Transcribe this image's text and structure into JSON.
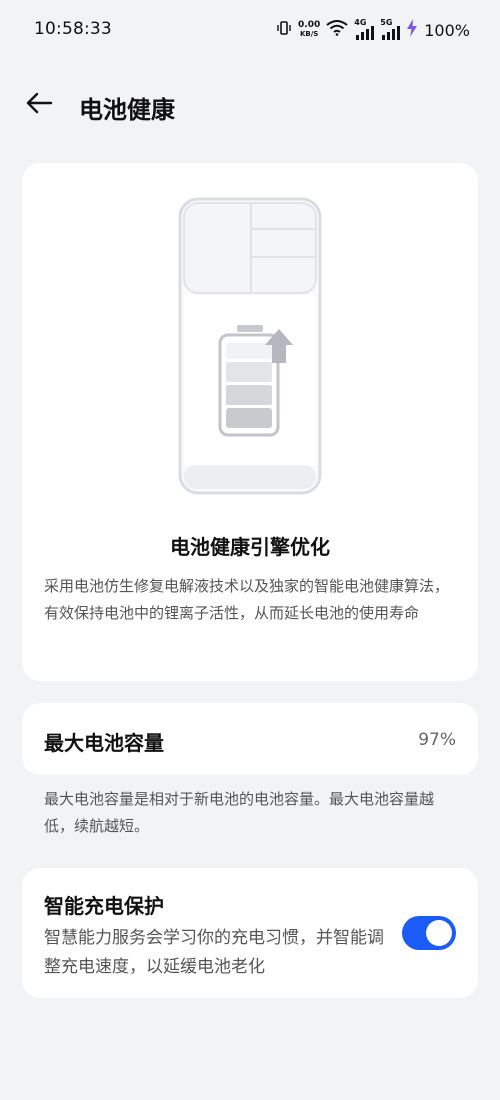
{
  "status_bar": {
    "time": "10:58:33",
    "net_speed_value": "0.00",
    "net_speed_unit": "KB/S",
    "sim1_gen": "4G",
    "sim2_gen": "5G",
    "battery_percent": "100%"
  },
  "header": {
    "title": "电池健康"
  },
  "hero": {
    "title": "电池健康引擎优化",
    "description": "采用电池仿生修复电解液技术以及独家的智能电池健康算法，有效保持电池中的锂离子活性，从而延长电池的使用寿命"
  },
  "capacity": {
    "label": "最大电池容量",
    "value": "97%",
    "note": "最大电池容量是相对于新电池的电池容量。最大电池容量越低，续航越短。"
  },
  "smart_charge": {
    "title": "智能充电保护",
    "description": "智慧能力服务会学习你的充电习惯，并智能调整充电速度，以延缓电池老化",
    "enabled": true
  },
  "colors": {
    "accent": "#1a5cf5",
    "background": "#f1f3f5",
    "card": "#ffffff"
  }
}
